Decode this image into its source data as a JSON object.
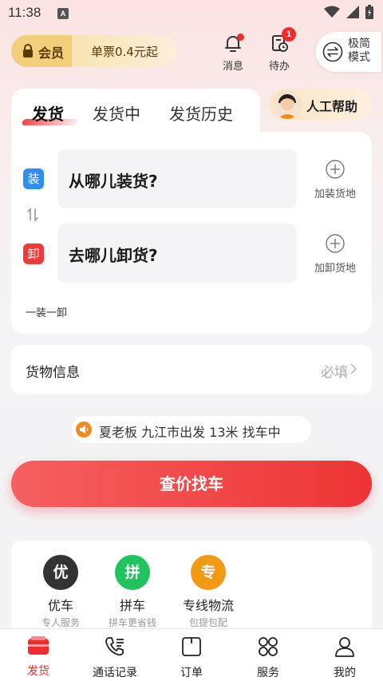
{
  "status": {
    "time": "11:38",
    "a_icon": "A"
  },
  "header": {
    "vip_label": "会员",
    "vip_promo": "单票0.4元起",
    "messages_label": "消息",
    "todo_label": "待办",
    "todo_badge": "1",
    "mode_label": "极简模式"
  },
  "tabs": [
    {
      "label": "发货",
      "active": true
    },
    {
      "label": "发货中",
      "active": false
    },
    {
      "label": "发货历史",
      "active": false
    }
  ],
  "help_label": "人工帮助",
  "loading": {
    "tag": "装",
    "placeholder": "从哪儿装货?",
    "add_label": "加装货地",
    "tag_color": "#2f8ff0"
  },
  "unloading": {
    "tag": "卸",
    "placeholder": "去哪儿卸货?",
    "add_label": "加卸货地",
    "tag_color": "#ee3b3b"
  },
  "mode_hint": "一装一卸",
  "goods": {
    "label": "货物信息",
    "required": "必填"
  },
  "notice": "夏老板 九江市出发 13米 找车中",
  "cta_label": "查价找车",
  "services": [
    {
      "icon": "优",
      "name": "优车",
      "sub": "专人服务",
      "color": "#333333"
    },
    {
      "icon": "拼",
      "name": "拼车",
      "sub": "拼车更省钱",
      "color": "#22c35e"
    },
    {
      "icon": "专",
      "name": "专线物流",
      "sub": "包提包配",
      "color": "#f39a14"
    }
  ],
  "tabbar": [
    {
      "label": "发货",
      "icon": "truck-icon",
      "active": true
    },
    {
      "label": "通话记录",
      "icon": "phone-icon",
      "active": false
    },
    {
      "label": "订单",
      "icon": "order-icon",
      "active": false
    },
    {
      "label": "服务",
      "icon": "grid-icon",
      "active": false
    },
    {
      "label": "我的",
      "icon": "person-icon",
      "active": false
    }
  ],
  "colors": {
    "accent": "#ee2d2d",
    "vip_gold": "#f3cf7c"
  }
}
